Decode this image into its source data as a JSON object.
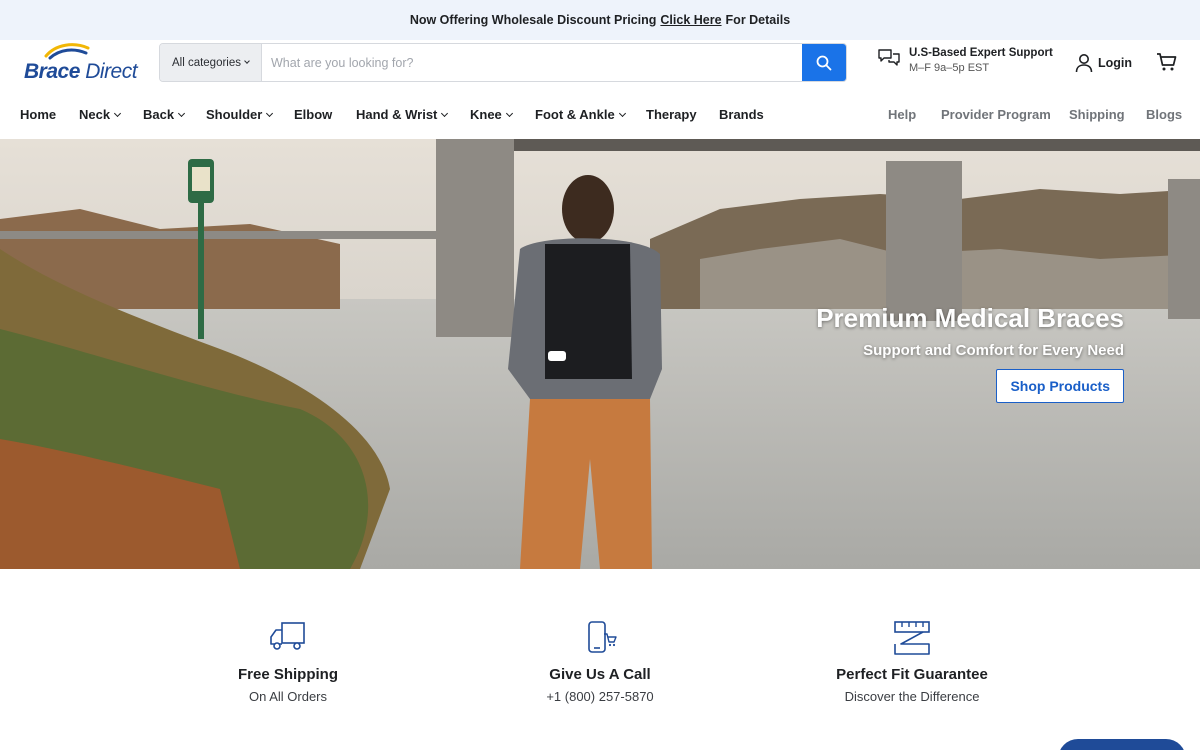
{
  "announcement": {
    "prefix": "Now Offering Wholesale Discount Pricing",
    "link": "Click Here",
    "suffix": "For Details"
  },
  "brand": {
    "logo_word1": "Brace",
    "logo_word2": "Direct",
    "color_primary": "#1f4b98",
    "color_accent": "#f2b705"
  },
  "search": {
    "category_label": "All categories",
    "placeholder": "What are you looking for?",
    "icon": "search-icon"
  },
  "support": {
    "title": "U.S-Based Expert Support",
    "hours": "M–F 9a–5p EST",
    "icon": "chat-bubbles-icon"
  },
  "account": {
    "login_label": "Login",
    "cart_icon": "cart-icon"
  },
  "nav": {
    "left": [
      {
        "label": "Home",
        "dropdown": false
      },
      {
        "label": "Neck",
        "dropdown": true
      },
      {
        "label": "Back",
        "dropdown": true
      },
      {
        "label": "Shoulder",
        "dropdown": true
      },
      {
        "label": "Elbow",
        "dropdown": false
      },
      {
        "label": "Hand & Wrist",
        "dropdown": true
      },
      {
        "label": "Knee",
        "dropdown": true
      },
      {
        "label": "Foot & Ankle",
        "dropdown": true
      },
      {
        "label": "Therapy",
        "dropdown": false
      },
      {
        "label": "Brands",
        "dropdown": false
      }
    ],
    "right": [
      {
        "label": "Help"
      },
      {
        "label": "Provider Program"
      },
      {
        "label": "Shipping"
      },
      {
        "label": "Blogs"
      }
    ]
  },
  "hero": {
    "title": "Premium Medical Braces",
    "subtitle": "Support and Comfort for Every Need",
    "button_label": "Shop Products",
    "button_color": "#1a5fc8"
  },
  "features": [
    {
      "title": "Free Shipping",
      "subtitle": "On All Orders",
      "icon": "delivery-truck-icon"
    },
    {
      "title": "Give Us A Call",
      "subtitle": "+1 (800) 257-5870",
      "icon": "phone-icon"
    },
    {
      "title": "Perfect Fit Guarantee",
      "subtitle": "Discover the Difference",
      "icon": "measuring-tape-icon"
    }
  ],
  "colors": {
    "search_button": "#1a73e8",
    "announcement_bg": "#eef3fb"
  }
}
